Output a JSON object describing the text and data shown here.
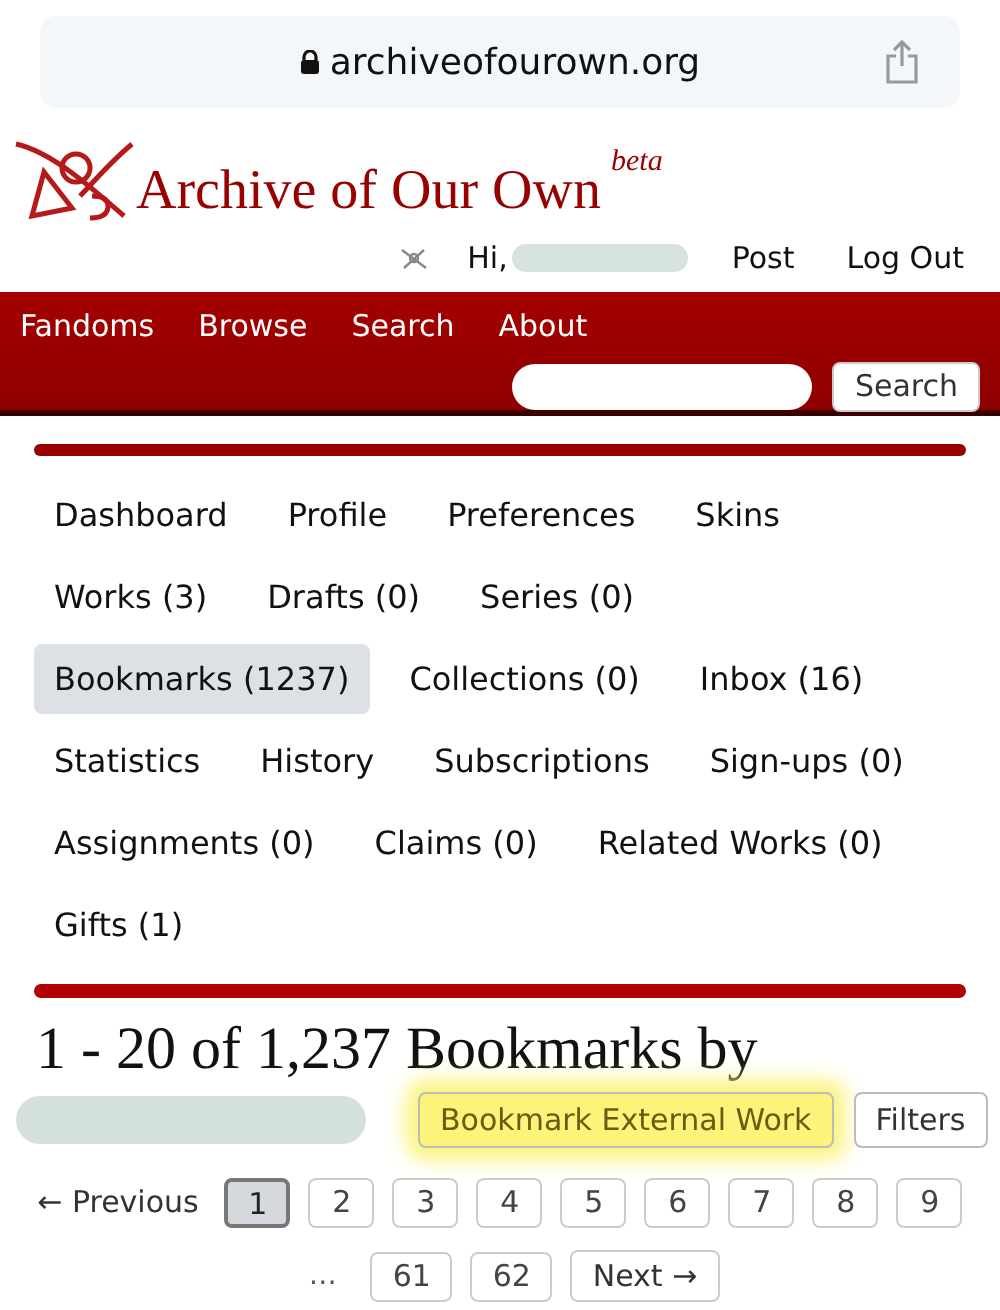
{
  "address_bar": {
    "url": "archiveofourown.org"
  },
  "site": {
    "name": "Archive of Our Own",
    "badge": "beta"
  },
  "user_nav": {
    "greeting": "Hi,",
    "links": [
      "Post",
      "Log Out"
    ]
  },
  "primary_nav": {
    "links": [
      "Fandoms",
      "Browse",
      "Search",
      "About"
    ],
    "search_button": "Search"
  },
  "dashboard_nav": [
    {
      "label": "Dashboard",
      "selected": false
    },
    {
      "label": "Profile",
      "selected": false
    },
    {
      "label": "Preferences",
      "selected": false
    },
    {
      "label": "Skins",
      "selected": false
    },
    {
      "label": "Works (3)",
      "selected": false
    },
    {
      "label": "Drafts (0)",
      "selected": false
    },
    {
      "label": "Series (0)",
      "selected": false
    },
    {
      "label": "Bookmarks (1237)",
      "selected": true
    },
    {
      "label": "Collections (0)",
      "selected": false
    },
    {
      "label": "Inbox (16)",
      "selected": false
    },
    {
      "label": "Statistics",
      "selected": false
    },
    {
      "label": "History",
      "selected": false
    },
    {
      "label": "Subscriptions",
      "selected": false
    },
    {
      "label": "Sign-ups (0)",
      "selected": false
    },
    {
      "label": "Assignments (0)",
      "selected": false
    },
    {
      "label": "Claims (0)",
      "selected": false
    },
    {
      "label": "Related Works (0)",
      "selected": false
    },
    {
      "label": "Gifts (1)",
      "selected": false
    }
  ],
  "heading": "1 - 20 of 1,237 Bookmarks by",
  "actions": [
    {
      "label": "Bookmark External Work",
      "highlighted": true
    },
    {
      "label": "Filters",
      "highlighted": false
    }
  ],
  "pagination": [
    {
      "kind": "prev",
      "label": "← Previous"
    },
    {
      "kind": "page",
      "label": "1",
      "selected": true
    },
    {
      "kind": "page",
      "label": "2",
      "selected": false
    },
    {
      "kind": "page",
      "label": "3",
      "selected": false
    },
    {
      "kind": "page",
      "label": "4",
      "selected": false
    },
    {
      "kind": "page",
      "label": "5",
      "selected": false
    },
    {
      "kind": "page",
      "label": "6",
      "selected": false
    },
    {
      "kind": "page",
      "label": "7",
      "selected": false
    },
    {
      "kind": "page",
      "label": "8",
      "selected": false
    },
    {
      "kind": "page",
      "label": "9",
      "selected": false
    },
    {
      "kind": "gap",
      "label": "…"
    },
    {
      "kind": "page",
      "label": "61",
      "selected": false
    },
    {
      "kind": "page",
      "label": "62",
      "selected": false
    },
    {
      "kind": "next",
      "label": "Next →"
    }
  ]
}
